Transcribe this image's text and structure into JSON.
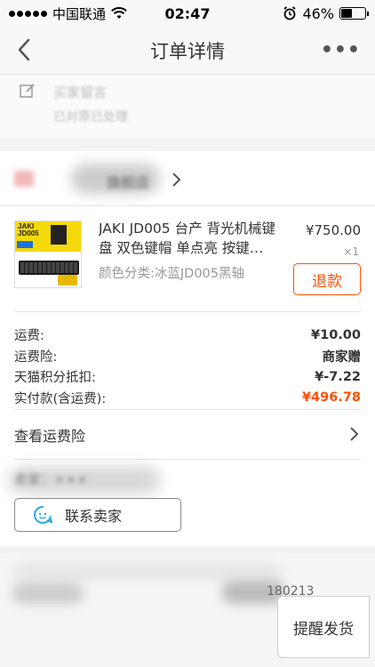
{
  "status_bar": {
    "carrier": "中国联通",
    "time": "02:47",
    "battery_percent": "46%",
    "battery_level": 0.46
  },
  "nav": {
    "title": "订单详情",
    "more": "•••"
  },
  "message": {
    "label": "买家留言",
    "text": "已对原已处理"
  },
  "shop": {
    "name": "旗舰店"
  },
  "product": {
    "title": "JAKI JD005 台产 背光机械键盘 双色键帽 单点亮 按键…",
    "price": "¥750.00",
    "qty": "×1",
    "sku": "颜色分类:冰蓝JD005黑轴",
    "refund_label": "退款",
    "image_brand": "JAKI JD005"
  },
  "summary": [
    {
      "label": "运费:",
      "value": "¥10.00"
    },
    {
      "label": "运费险:",
      "value": "商家赠"
    },
    {
      "label": "天猫积分抵扣:",
      "value": "¥-7.22"
    },
    {
      "label": "实付款(含运费):",
      "value": "¥496.78"
    }
  ],
  "insurance": {
    "label": "查看运费险"
  },
  "seller": {
    "label": "卖家：×××",
    "contact_label": "联系卖家"
  },
  "info": {
    "order_number_tail": "180213"
  },
  "actions": {
    "remind_label": "提醒发货"
  },
  "colors": {
    "accent": "#ff5000",
    "background": "#f2f2f2"
  }
}
